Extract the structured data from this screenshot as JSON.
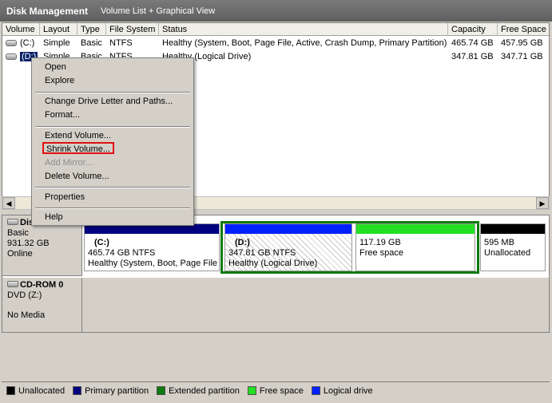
{
  "titlebar": {
    "app": "Disk Management",
    "view": "Volume List + Graphical View"
  },
  "columns": [
    "Volume",
    "Layout",
    "Type",
    "File System",
    "Status",
    "Capacity",
    "Free Space"
  ],
  "rows": [
    {
      "volume": "(C:)",
      "layout": "Simple",
      "type": "Basic",
      "fs": "NTFS",
      "status": "Healthy (System, Boot, Page File, Active, Crash Dump, Primary Partition)",
      "capacity": "465.74 GB",
      "free": "457.95 GB"
    },
    {
      "volume": "(D:)",
      "layout": "Simple",
      "type": "Basic",
      "fs": "NTFS",
      "status": "Healthy (Logical Drive)",
      "capacity": "347.81 GB",
      "free": "347.71 GB"
    }
  ],
  "menu": {
    "open": "Open",
    "explore": "Explore",
    "change_letter": "Change Drive Letter and Paths...",
    "format": "Format...",
    "extend": "Extend Volume...",
    "shrink": "Shrink Volume...",
    "add_mirror": "Add Mirror...",
    "delete": "Delete Volume...",
    "properties": "Properties",
    "help": "Help"
  },
  "disk0": {
    "name": "Disk 0",
    "type": "Basic",
    "size": "931.32 GB",
    "state": "Online",
    "partitions": [
      {
        "title": "(C:)",
        "size": "465.74 GB NTFS",
        "status": "Healthy (System, Boot, Page File"
      },
      {
        "title": "(D:)",
        "size": "347.81 GB NTFS",
        "status": "Healthy (Logical Drive)"
      },
      {
        "title": "",
        "size": "117.19 GB",
        "status": "Free space"
      },
      {
        "title": "",
        "size": "595 MB",
        "status": "Unallocated"
      }
    ]
  },
  "cdrom": {
    "name": "CD-ROM 0",
    "drive": "DVD (Z:)",
    "media": "No Media"
  },
  "legend": [
    {
      "label": "Unallocated",
      "color": "#000000"
    },
    {
      "label": "Primary partition",
      "color": "#000080"
    },
    {
      "label": "Extended partition",
      "color": "#0c7a0c"
    },
    {
      "label": "Free space",
      "color": "#22e022"
    },
    {
      "label": "Logical drive",
      "color": "#0020ff"
    }
  ]
}
